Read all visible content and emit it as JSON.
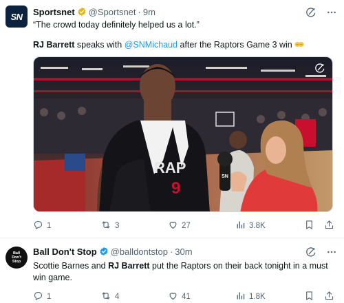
{
  "tweets": [
    {
      "author_name": "Sportsnet",
      "handle": "@Sportsnet",
      "separator": "·",
      "time": "9m",
      "line1": "“The crowd today definitely helped us a lot.”",
      "line2_bold": "RJ Barrett",
      "line2_mid": " speaks with ",
      "line2_mention": "@SNMichaud",
      "line2_end": " after the Raptors Game 3 win ",
      "media": {
        "jersey_text": "RAP",
        "jersey_number": "9",
        "mic_flag": "SN"
      },
      "stats": {
        "replies": "1",
        "retweets": "3",
        "likes": "27",
        "views": "3.8K"
      },
      "avatar_text": "SN"
    },
    {
      "author_name": "Ball Don't Stop",
      "handle": "@balldontstop",
      "separator": "·",
      "time": "30m",
      "text_a": "Scottie Barnes and ",
      "text_bold": "RJ Barrett",
      "text_b": " put the Raptors on their back tonight in a must win game.",
      "avatar_text": "Ball Don't Stop",
      "stats": {
        "replies": "1",
        "retweets": "4",
        "likes": "41",
        "views": "1.8K"
      }
    }
  ],
  "colors": {
    "verified": "#e2b719",
    "accent": "#1d9bf0",
    "muted": "#536471"
  },
  "icons": [
    "verified-badge-icon",
    "grok-icon",
    "more-icon",
    "reply-icon",
    "retweet-icon",
    "like-icon",
    "views-icon",
    "bookmark-icon",
    "share-icon",
    "emoji-icon"
  ]
}
